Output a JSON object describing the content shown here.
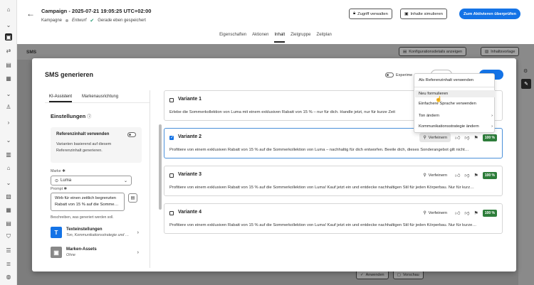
{
  "campaign": {
    "title": "Campaign - 2025-07-21 19:05:25 UTC+02:00",
    "type": "Kampagne",
    "status": "Entwurf",
    "saved": "Gerade eben gespeichert"
  },
  "header_buttons": {
    "access": "Zugriff verwalten",
    "simulate": "Inhalte simulieren",
    "activate": "Zum Aktivieren überprüfen"
  },
  "tabs": [
    "Eigenschaften",
    "Aktionen",
    "Inhalt",
    "Zielgruppe",
    "Zeitplan"
  ],
  "active_tab": "Inhalt",
  "sms_bar": {
    "label": "SMS",
    "config_button": "Konfigurationsdetails anzeigen",
    "template_button": "Inhaltsvorlage"
  },
  "bottom": {
    "apply": "Anwenden",
    "preview": "Vorschau"
  },
  "modal": {
    "title": "SMS generieren",
    "experiment_label": "Experime",
    "left_tabs": [
      "KI-Assistent",
      "Markenausrichtung"
    ],
    "settings_title": "Einstellungen",
    "ref_content": {
      "title": "Referenzinhalt verwenden",
      "description": "Varianten basierend auf diesem Referenzinhalt generieren."
    },
    "brand_label": "Marke",
    "brand_value": "Luma",
    "prompt_label": "Prompt",
    "prompt_value": "Wirb für einen zeitlich begrenzten Rabatt von 15 % auf die Somme…",
    "prompt_hint": "Beschreiben, was generiert werden soll.",
    "text_settings": {
      "title": "Texteinstellungen",
      "subtitle": "Ton, Kommunikationsstrategie und …"
    },
    "brand_assets": {
      "title": "Marken-Assets",
      "subtitle": "Ohne"
    }
  },
  "variants": [
    {
      "title": "Variante 1",
      "text": "Erlebe die Sommerkollektion von Luma mit einem exklusiven Rabatt von 15 % – nur für dich. Handle jetzt, nur für kurze Zeit",
      "checked": false
    },
    {
      "title": "Variante 2",
      "text": "Profitiere von einem exklusiven Rabatt von 15 % auf die Sommerkollektion von Luma – nachhaltig für dich entworfen. Beeile dich, dieses Sonderangebot gilt nicht…",
      "checked": true,
      "refine": "Verfeinern",
      "score": "100 %"
    },
    {
      "title": "Variante 3",
      "text": "Profitiere von einem exklusiven Rabatt von 15 % auf die Sommerkollektion von Luma! Kauf jetzt ein und entdecke nachhaltigen Stil für jeden Körperbau. Nur für kurz…",
      "checked": false,
      "refine": "Verfeinern",
      "score": "100 %"
    },
    {
      "title": "Variante 4",
      "text": "Profitiere von einem exklusiven Rabatt von 15 % auf die Sommerkollektion von Luma! Kauf jetzt ein und entdecke nachhaltigen Stil für jeden Körperbau. Nur für kurze…",
      "checked": false,
      "refine": "Verfeinern",
      "score": "100 %"
    }
  ],
  "context_menu": {
    "items": [
      "Als Referenzinhalt verwenden",
      "Neu formulieren",
      "Einfachere Sprache verwenden",
      "Ton ändern",
      "Kommunikationsstrategie ändern"
    ]
  },
  "colors": {
    "accent": "#1473e6",
    "score_green": "#2d7d3a",
    "saved_green": "#2d9d78"
  }
}
